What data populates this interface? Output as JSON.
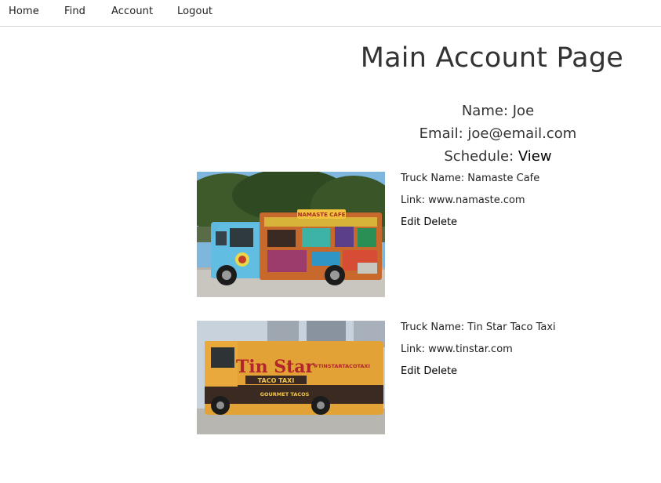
{
  "nav": {
    "home": "Home",
    "find": "Find",
    "account": "Account",
    "logout": "Logout"
  },
  "page": {
    "title": "Main Account Page"
  },
  "profile": {
    "name_label": "Name:",
    "name": "Joe",
    "email_label": "Email:",
    "email": "joe@email.com",
    "schedule_label": "Schedule:",
    "schedule_link": "View"
  },
  "trucks": [
    {
      "name_label": "Truck Name:",
      "name": "Namaste Cafe",
      "link_label": "Link:",
      "link": "www.namaste.com",
      "edit_label": "Edit",
      "delete_label": "Delete",
      "photo_sign": "NAMASTE CAFE",
      "body_color": "#4aa9d6"
    },
    {
      "name_label": "Truck Name:",
      "name": "Tin Star Taco Taxi",
      "link_label": "Link:",
      "link": "www.tinstar.com",
      "edit_label": "Edit",
      "delete_label": "Delete",
      "photo_sign_1": "Tin Star",
      "photo_sign_2": "TACO TAXI",
      "photo_sign_3": "GOURMET TACOS",
      "photo_sign_4": "#TINSTARTACOTAXI",
      "body_color": "#e8a233"
    }
  ]
}
